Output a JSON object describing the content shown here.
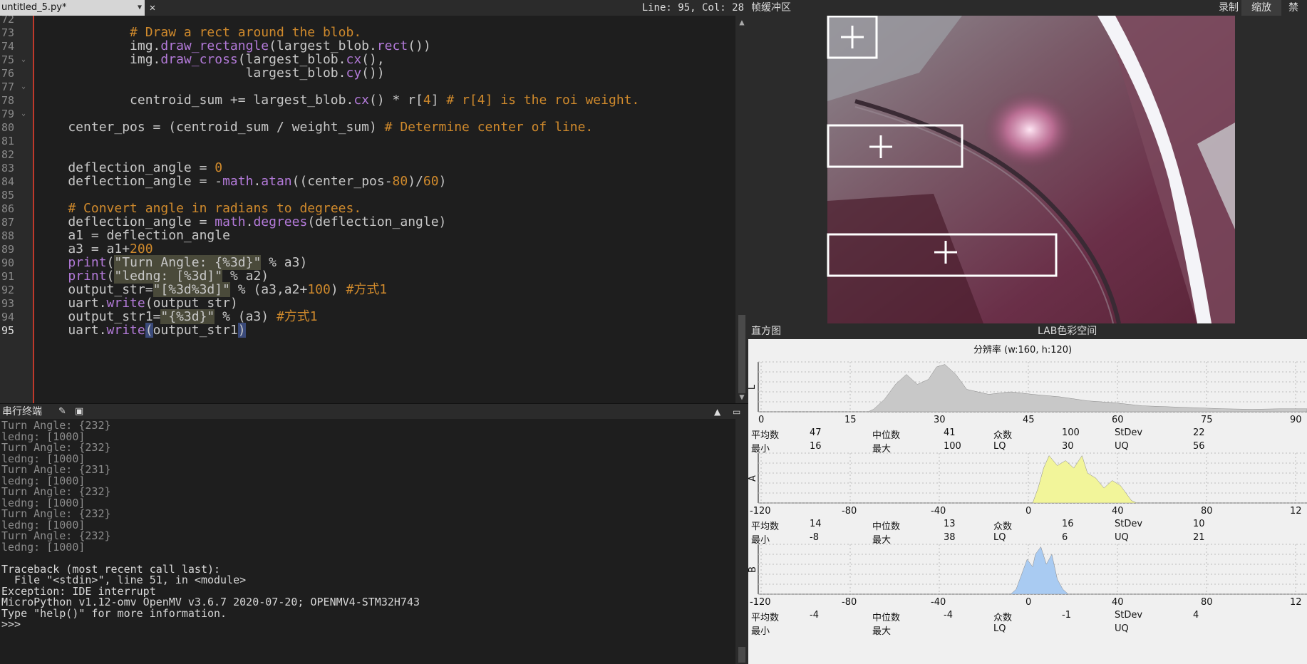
{
  "editor": {
    "tab_name": "untitled_5.py*",
    "tab_dropdown_icon": "chevron-down-icon",
    "tab_close_icon": "close-icon",
    "cursor_status": "Line: 95, Col: 28",
    "line_numbers": [
      "72",
      "73",
      "74",
      "75",
      "76",
      "77",
      "78",
      "79",
      "80",
      "81",
      "82",
      "83",
      "84",
      "85",
      "86",
      "87",
      "88",
      "89",
      "90",
      "91",
      "92",
      "93",
      "94",
      "95"
    ],
    "lines": [
      "",
      "            # Draw a rect around the blob.",
      "            img.draw_rectangle(largest_blob.rect())",
      "            img.draw_cross(largest_blob.cx(),",
      "                           largest_blob.cy())",
      "",
      "            centroid_sum += largest_blob.cx() * r[4] # r[4] is the roi weight.",
      "",
      "    center_pos = (centroid_sum / weight_sum) # Determine center of line.",
      "",
      "",
      "    deflection_angle = 0",
      "    deflection_angle = -math.atan((center_pos-80)/60)",
      "",
      "    # Convert angle in radians to degrees.",
      "    deflection_angle = math.degrees(deflection_angle)",
      "    a1 = deflection_angle",
      "    a3 = a1+200",
      "    print(\"Turn Angle: {%3d}\" % a3)",
      "    print(\"ledng: [%3d]\" % a2)",
      "    output_str=\"[%3d%3d]\" % (a3,a2+100) #方式1",
      "    uart.write(output_str)",
      "    output_str1=\"{%3d}\" % (a3) #方式1",
      "    uart.write(output_str1)"
    ]
  },
  "terminal": {
    "title": "串行终端",
    "lines": [
      "Turn Angle: {232}",
      "ledng: [1000]",
      "Turn Angle: {232}",
      "ledng: [1000]",
      "Turn Angle: {231}",
      "ledng: [1000]",
      "Turn Angle: {232}",
      "ledng: [1000]",
      "Turn Angle: {232}",
      "ledng: [1000]",
      "Turn Angle: {232}",
      "ledng: [1000]",
      "",
      "Traceback (most recent call last):",
      "  File \"<stdin>\", line 51, in <module>",
      "Exception: IDE interrupt",
      "MicroPython v1.12-omv OpenMV v3.6.7 2020-07-20; OPENMV4-STM32H743",
      "Type \"help()\" for more information.",
      ">>>"
    ]
  },
  "framebuffer": {
    "title": "帧缓冲区",
    "record": "录制",
    "zoom": "缩放",
    "disable": "禁用"
  },
  "histogram": {
    "title": "直方图",
    "colorspace": "LAB色彩空间",
    "resolution": "分辨率 (w:160, h:120)",
    "labels": {
      "mean": "平均数",
      "median": "中位数",
      "mode": "众数",
      "stdev": "StDev",
      "min": "最小",
      "max": "最大",
      "lq": "LQ",
      "uq": "UQ"
    },
    "channels": [
      {
        "name": "L",
        "color": "#c8c8c8",
        "ticks": [
          "0",
          "15",
          "30",
          "45",
          "60",
          "75",
          "90"
        ],
        "stats": {
          "mean": "47",
          "median": "41",
          "mode": "100",
          "stdev": "22",
          "min": "16",
          "max": "100",
          "lq": "30",
          "uq": "56"
        }
      },
      {
        "name": "A",
        "color": "#f2f59a",
        "ticks": [
          "-120",
          "-80",
          "-40",
          "0",
          "40",
          "80",
          "12"
        ],
        "stats": {
          "mean": "14",
          "median": "13",
          "mode": "16",
          "stdev": "10",
          "min": "-8",
          "max": "38",
          "lq": "6",
          "uq": "21"
        }
      },
      {
        "name": "B",
        "color": "#a9cbf2",
        "ticks": [
          "-120",
          "-80",
          "-40",
          "0",
          "40",
          "80",
          "12"
        ],
        "stats": {
          "mean": "-4",
          "median": "-4",
          "mode": "-1",
          "stdev": "4",
          "min": "",
          "max": "",
          "lq": "",
          "uq": ""
        }
      }
    ]
  }
}
